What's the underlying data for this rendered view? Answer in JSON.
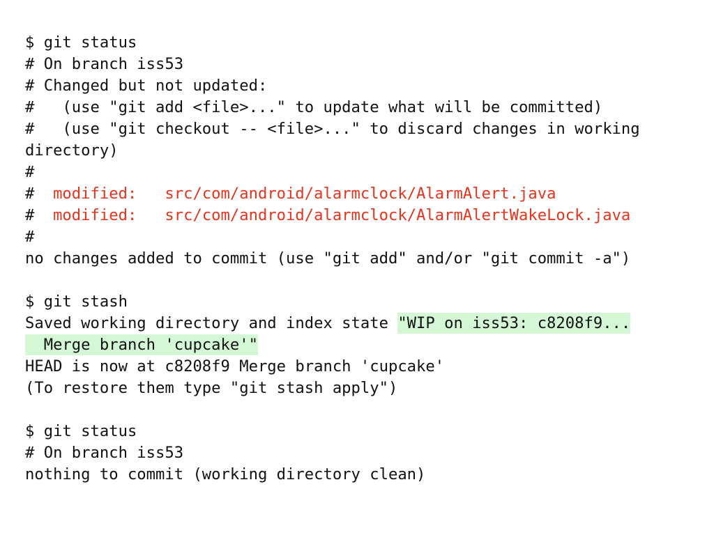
{
  "colors": {
    "background": "#ffffff",
    "text": "#111111",
    "modified": "#e8341c",
    "highlight": "#d4f7d6"
  },
  "block1": {
    "cmd": "$ git status",
    "branch": "# On branch iss53",
    "changed": "# Changed but not updated:",
    "hint_add": "#   (use \"git add <file>...\" to update what will be committed)",
    "hint_checkout": "#   (use \"git checkout -- <file>...\" to discard changes in working",
    "hint_checkout_cont": "directory)",
    "hash1": "#",
    "mod1_prefix": "#  ",
    "mod1_label": "modified:",
    "mod1_file": "src/com/android/alarmclock/AlarmAlert.java",
    "mod2_prefix": "#  ",
    "mod2_label": "modified:",
    "mod2_file": "src/com/android/alarmclock/AlarmAlertWakeLock.java",
    "hash2": "#",
    "summary": "no changes added to commit (use \"git add\" and/or \"git commit -a\")"
  },
  "block2": {
    "cmd": "$ git stash",
    "saved_prefix": "Saved working directory and index state ",
    "saved_msg1": "\"WIP on iss53: c8208f9...",
    "saved_msg2": "  Merge branch 'cupcake'\"",
    "head": "HEAD is now at c8208f9 Merge branch 'cupcake'",
    "restore": "(To restore them type \"git stash apply\")"
  },
  "block3": {
    "cmd": "$ git status",
    "branch": "# On branch iss53",
    "clean": "nothing to commit (working directory clean)"
  }
}
